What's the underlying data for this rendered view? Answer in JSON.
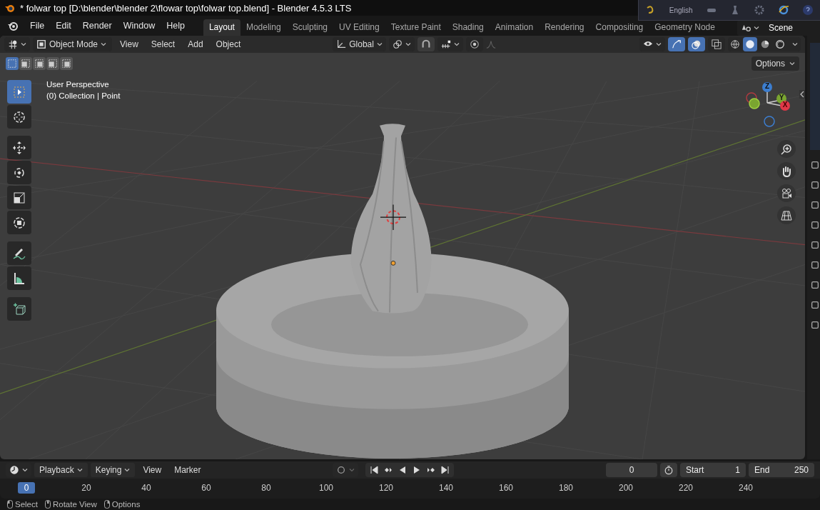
{
  "window": {
    "title": "* folwar top [D:\\blender\\blender 2\\flowar top\\folwar top.blend] - Blender 4.5.3 LTS"
  },
  "language_bar": {
    "language": "English"
  },
  "menu": [
    "File",
    "Edit",
    "Render",
    "Window",
    "Help"
  ],
  "workspaces": [
    {
      "label": "Layout",
      "selected": true
    },
    {
      "label": "Modeling",
      "selected": false
    },
    {
      "label": "Sculpting",
      "selected": false
    },
    {
      "label": "UV Editing",
      "selected": false
    },
    {
      "label": "Texture Paint",
      "selected": false
    },
    {
      "label": "Shading",
      "selected": false
    },
    {
      "label": "Animation",
      "selected": false
    },
    {
      "label": "Rendering",
      "selected": false
    },
    {
      "label": "Compositing",
      "selected": false
    },
    {
      "label": "Geometry Node",
      "selected": false
    }
  ],
  "scene": "Scene",
  "viewport_header": {
    "mode": "Object Mode",
    "menus": [
      "View",
      "Select",
      "Add",
      "Object"
    ],
    "orientation": "Global",
    "gizmos_on": true,
    "overlays_on": true,
    "shading": [
      {
        "kind": "wireframe",
        "selected": false
      },
      {
        "kind": "solid",
        "selected": true
      },
      {
        "kind": "material",
        "selected": false
      },
      {
        "kind": "rendered",
        "selected": false
      }
    ]
  },
  "select_modes": [
    {
      "selected": true
    },
    {
      "selected": false
    },
    {
      "selected": false
    },
    {
      "selected": false
    },
    {
      "selected": false
    }
  ],
  "options": "Options",
  "overlay_text": [
    "User Perspective",
    "(0) Collection | Point"
  ],
  "tools": [
    {
      "kind": "select",
      "selected": true
    },
    {
      "kind": "cursor",
      "selected": false
    },
    {
      "kind": "move",
      "selected": false
    },
    {
      "kind": "rotate",
      "selected": false
    },
    {
      "kind": "scale",
      "selected": false
    },
    {
      "kind": "transform",
      "selected": false
    },
    {
      "kind": "annotate",
      "selected": false
    },
    {
      "kind": "measure",
      "selected": false
    },
    {
      "kind": "add-cube",
      "selected": false
    }
  ],
  "gizmo_axes": [
    "Z",
    "Y",
    "X"
  ],
  "timeline": {
    "auto_keying_on": false,
    "menus": [
      {
        "label": "Playback",
        "dropdown": true
      },
      {
        "label": "Keying",
        "dropdown": true
      },
      {
        "label": "View",
        "dropdown": false
      },
      {
        "label": "Marker",
        "dropdown": false
      }
    ],
    "current_frame": "0",
    "start_label": "Start",
    "start": "1",
    "end_label": "End",
    "end": "250",
    "ruler": [
      "0",
      "20",
      "40",
      "60",
      "80",
      "100",
      "120",
      "140",
      "160",
      "180",
      "200",
      "220",
      "240"
    ]
  },
  "status_bar": [
    "Select",
    "Rotate View",
    "Options"
  ]
}
